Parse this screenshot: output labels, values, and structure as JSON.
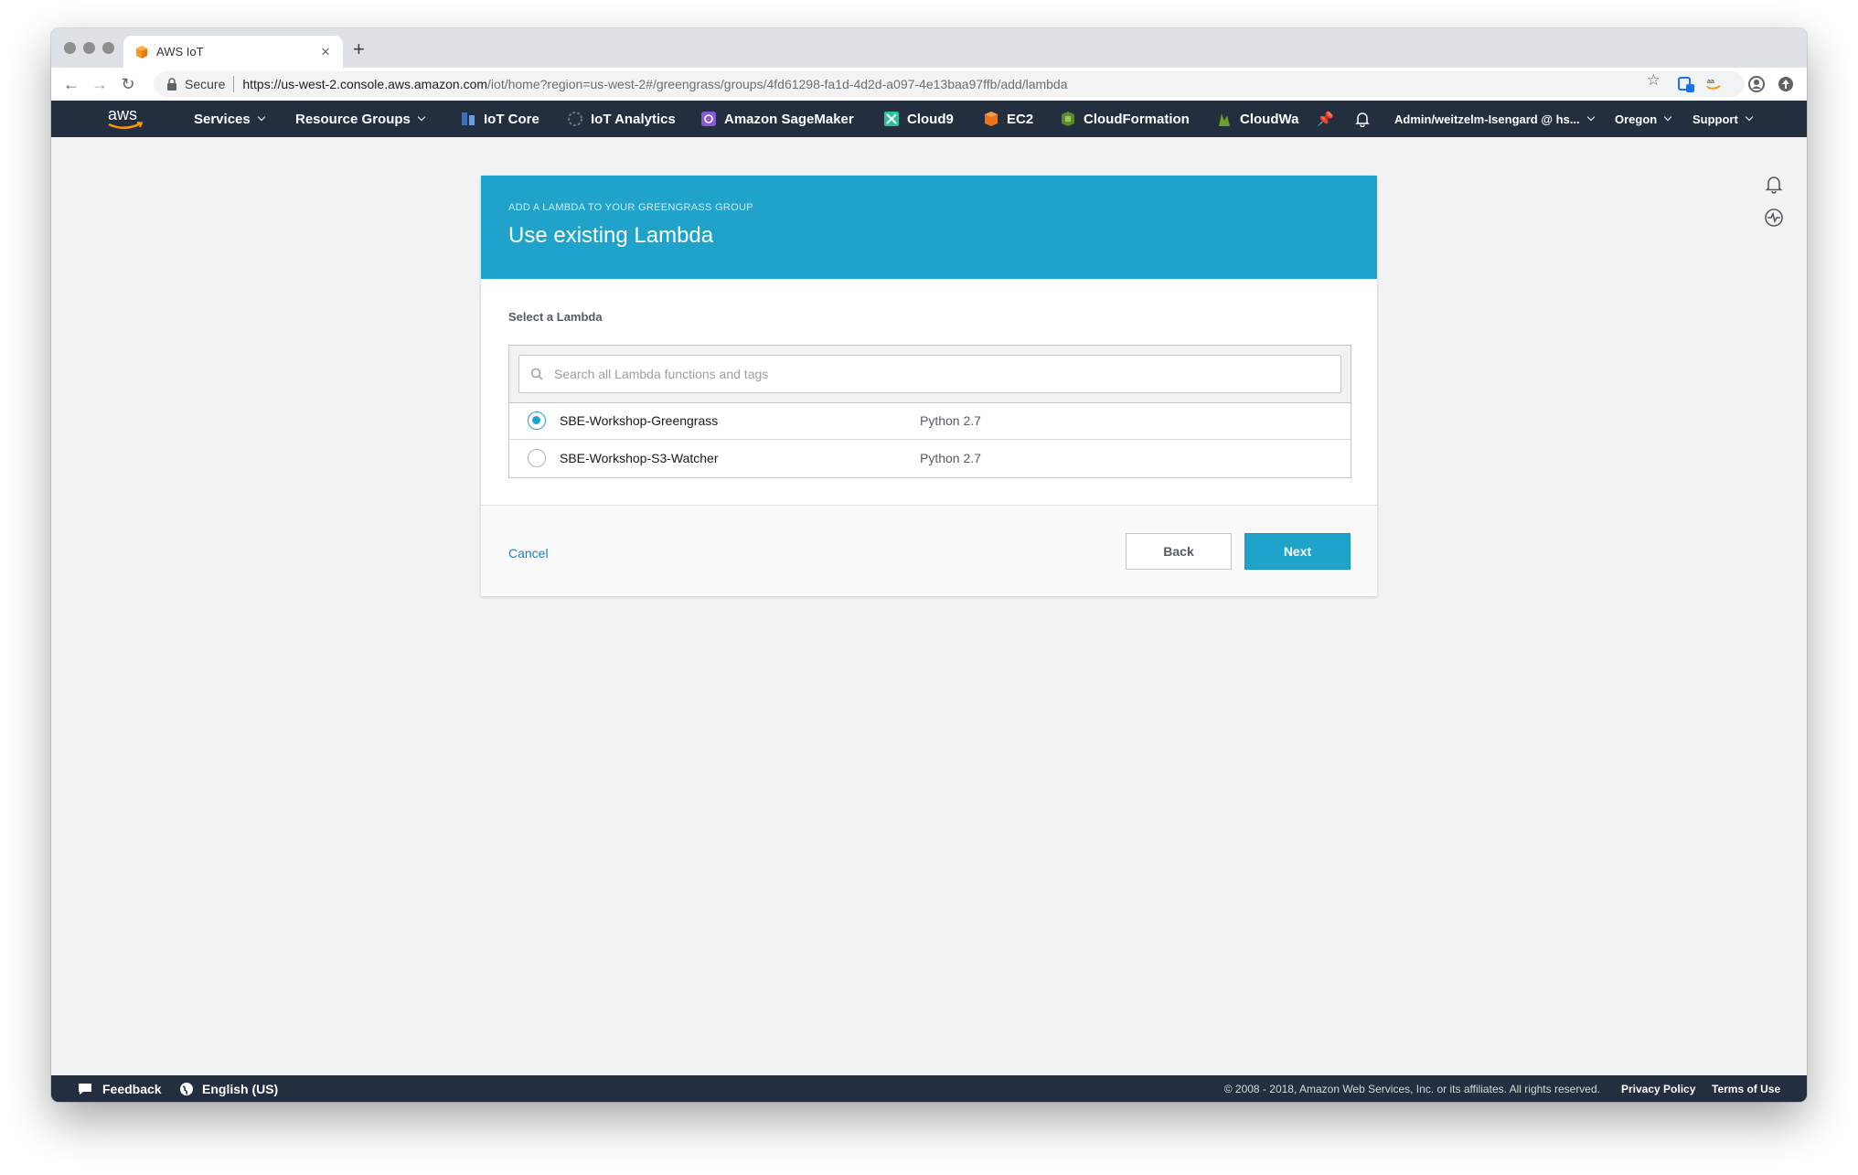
{
  "browser": {
    "tab_title": "AWS IoT",
    "secure_label": "Secure",
    "url_host": "https://us-west-2.console.aws.amazon.com",
    "url_path": "/iot/home?region=us-west-2#/greengrass/groups/4fd61298-fa1d-4d2d-a097-4e13baa97ffb/add/lambda"
  },
  "nav": {
    "logo_text": "aws",
    "services": "Services",
    "resource_groups": "Resource Groups",
    "pinned": [
      {
        "label": "IoT Core",
        "icon": "iot-core-icon"
      },
      {
        "label": "IoT Analytics",
        "icon": "iot-analytics-icon"
      },
      {
        "label": "Amazon SageMaker",
        "icon": "sagemaker-icon"
      },
      {
        "label": "Cloud9",
        "icon": "cloud9-icon"
      },
      {
        "label": "EC2",
        "icon": "ec2-icon"
      },
      {
        "label": "CloudFormation",
        "icon": "cloudformation-icon"
      },
      {
        "label": "CloudWa",
        "icon": "cloudwatch-icon"
      }
    ],
    "account": "Admin/weitzelm-Isengard @ hs...",
    "region": "Oregon",
    "support": "Support"
  },
  "wizard": {
    "eyebrow": "ADD A LAMBDA TO YOUR GREENGRASS GROUP",
    "title": "Use existing Lambda",
    "section_label": "Select a Lambda",
    "search_placeholder": "Search all Lambda functions and tags",
    "functions": [
      {
        "name": "SBE-Workshop-Greengrass",
        "runtime": "Python 2.7",
        "selected": true
      },
      {
        "name": "SBE-Workshop-S3-Watcher",
        "runtime": "Python 2.7",
        "selected": false
      }
    ],
    "cancel_label": "Cancel",
    "back_label": "Back",
    "next_label": "Next"
  },
  "footer": {
    "feedback": "Feedback",
    "language": "English (US)",
    "copyright": "© 2008 - 2018, Amazon Web Services, Inc. or its affiliates. All rights reserved.",
    "privacy": "Privacy Policy",
    "terms": "Terms of Use"
  },
  "colors": {
    "header_blue": "#1fa3cb",
    "nav_dark": "#232f3e",
    "link_blue": "#1d7fb8"
  }
}
